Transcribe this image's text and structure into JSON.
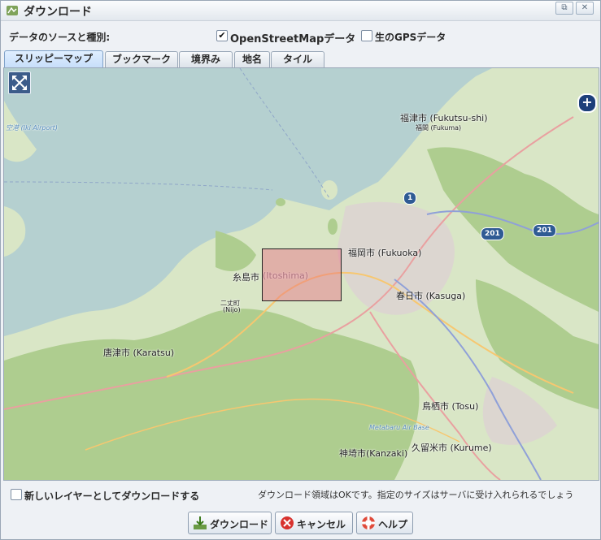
{
  "window": {
    "title": "ダウンロード",
    "buttons": [
      "⧉",
      "✕"
    ]
  },
  "source": {
    "label": "デ‌ータのソ‌ースと種別:",
    "options": [
      {
        "label": "OpenStreetMapデ‌ータ",
        "checked": true
      },
      {
        "label": "生のGPSデ‌ータ",
        "checked": false
      }
    ]
  },
  "tabs": [
    {
      "label": "スリッピ‌ーマップ",
      "active": true
    },
    {
      "label": "ブックマ‌ーク",
      "active": false
    },
    {
      "label": "境界‌み",
      "active": false
    },
    {
      "label": "地名",
      "active": false
    },
    {
      "label": "タイル‌",
      "active": false
    }
  ],
  "map": {
    "labels": {
      "fukutsu": "福津市 (Fukutsu-shi)",
      "fukuma": "福間 (Fukuma)",
      "fukuoka": "福岡市 (Fukuoka)",
      "itoshima_jp": "糸島市",
      "itoshima": "(Itoshima)",
      "nijo_jp": "二丈町",
      "nijo": "(Nijo)",
      "kasuga": "春日市 (Kasuga)",
      "karatsu": "唐津市 (Karatsu)",
      "tosu": "鳥栖市 (Tosu)",
      "kanzaki": "神埼市(Kanzaki)",
      "kurume": "久留米市 (Kurume)",
      "metabaru": "Metabaru Air Base",
      "airport": "空港 (Iki Airport)"
    },
    "shields": [
      "1",
      "201",
      "201"
    ]
  },
  "new_layer": {
    "label": "新しいレイヤ‌ーとしてダウンロ‌ードする",
    "checked": false
  },
  "status": "ダウンロ‌ード領域はOKです。指定のサイズはサ‌ーバに受け入れられるでしょう",
  "buttons": {
    "download": "ダウンロ‌ード",
    "cancel": "キャンセル",
    "help": "ヘルプ"
  },
  "colors": {
    "sea": "#b5d0d0",
    "land": "#d9e6c6",
    "forest": "#aecd8f",
    "selection": "#e86e82"
  }
}
